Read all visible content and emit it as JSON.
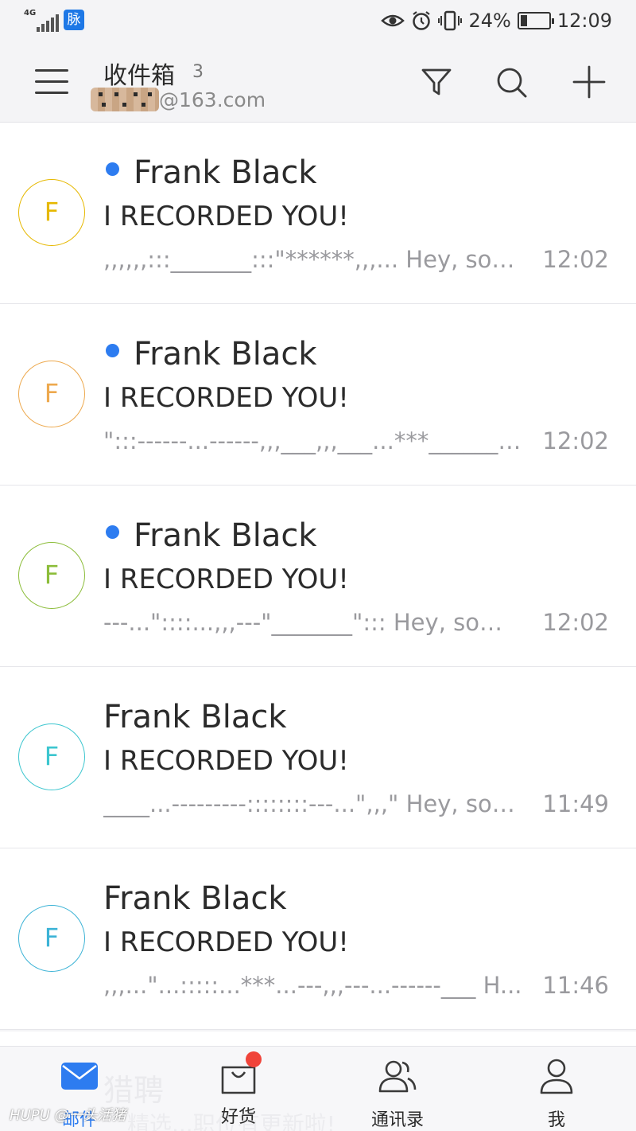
{
  "status_bar": {
    "network": "4G",
    "app_badge": "脉",
    "battery": "24%",
    "battery_level": 0.24,
    "time": "12:09",
    "icons": [
      "eye-icon",
      "alarm-icon",
      "vibrate-icon"
    ]
  },
  "header": {
    "title": "收件箱",
    "unread_count": "3",
    "account_suffix": "@163.com",
    "icons": [
      "menu-icon",
      "filter-icon",
      "search-icon",
      "plus-icon"
    ]
  },
  "emails": [
    {
      "avatar_letter": "F",
      "avatar_color": "#e6b800",
      "unread": true,
      "sender": "Frank Black",
      "subject": "I RECORDED YOU!",
      "preview": ",,,,,,:::_______:::\"******,,,... Hey, som...",
      "time": "12:02"
    },
    {
      "avatar_letter": "F",
      "avatar_color": "#eda94e",
      "unread": true,
      "sender": "Frank Black",
      "subject": "I RECORDED YOU!",
      "preview": "\":::------...------,,,___,,,___...***_______....",
      "time": "12:02"
    },
    {
      "avatar_letter": "F",
      "avatar_color": "#8cbd3a",
      "unread": true,
      "sender": "Frank Black",
      "subject": "I RECORDED YOU!",
      "preview": "---...\"::::...,,,---\"_______\"::: Hey, some...",
      "time": "12:02"
    },
    {
      "avatar_letter": "F",
      "avatar_color": "#3cc6cf",
      "unread": false,
      "sender": "Frank Black",
      "subject": "I RECORDED YOU!",
      "preview": "____...---------::::::::---...\",,,\" Hey, som...",
      "time": "11:49"
    },
    {
      "avatar_letter": "F",
      "avatar_color": "#3cb3d6",
      "unread": false,
      "sender": "Frank Black",
      "subject": "I RECORDED YOU!",
      "preview": ",,,...\"...:::::...***...---,,,---...------___ H...",
      "time": "11:46"
    }
  ],
  "ad_overlay": {
    "line1": "猎聘",
    "line2": "精选...职位有更新啦!"
  },
  "bottom_nav": [
    {
      "label": "邮件",
      "icon": "mail-icon",
      "active": true
    },
    {
      "label": "好货",
      "icon": "shopping-bag-icon",
      "active": false,
      "badge": true
    },
    {
      "label": "通讯录",
      "icon": "contacts-icon",
      "active": false
    },
    {
      "label": "我",
      "icon": "profile-icon",
      "active": false
    }
  ],
  "watermark": "HUPU @一头活猪",
  "colors": {
    "accent": "#2d7cf0",
    "badge": "#f0443a",
    "preview_text": "#9a9a9e"
  }
}
